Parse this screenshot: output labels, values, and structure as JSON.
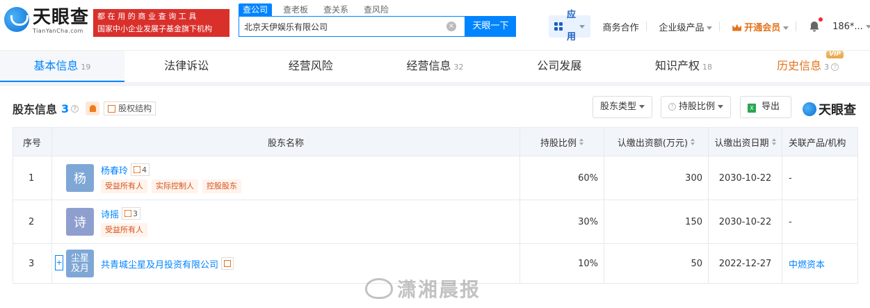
{
  "header": {
    "logo_cn": "天眼查",
    "logo_en": "TianYanCha.com",
    "slogan_line1": "都在用的商业查询工具",
    "slogan_line2": "国家中小企业发展子基金旗下机构",
    "search_tabs": [
      "查公司",
      "查老板",
      "查关系",
      "查风险"
    ],
    "search_value": "北京天伊娱乐有限公司",
    "search_button": "天眼一下",
    "nav": {
      "app": "应用",
      "business": "商务合作",
      "enterprise": "企业级产品",
      "vip": "开通会员",
      "user": "186*..."
    }
  },
  "tabs": [
    {
      "label": "基本信息",
      "count": "19"
    },
    {
      "label": "法律诉讼",
      "count": ""
    },
    {
      "label": "经营风险",
      "count": ""
    },
    {
      "label": "经营信息",
      "count": "32"
    },
    {
      "label": "公司发展",
      "count": ""
    },
    {
      "label": "知识产权",
      "count": "18"
    },
    {
      "label": "历史信息",
      "count": "3",
      "badge": "VIP"
    }
  ],
  "section": {
    "title": "股东信息",
    "count": "3",
    "structure_btn": "股权结构",
    "filter_type": "股东类型",
    "filter_ratio": "持股比例",
    "export": "导出",
    "brand": "天眼查"
  },
  "table": {
    "headers": [
      "序号",
      "股东名称",
      "持股比例",
      "认缴出资额(万元)",
      "认缴出资日期",
      "关联产品/机构"
    ],
    "rows": [
      {
        "index": "1",
        "avatar": "杨",
        "avatar_color": "#7fa7d6",
        "name": "杨春玲",
        "rel_count": "4",
        "tags": [
          "受益所有人",
          "实际控制人",
          "控股股东"
        ],
        "ratio": "60%",
        "amount": "300",
        "date": "2030-10-22",
        "related": "-"
      },
      {
        "index": "2",
        "avatar": "诗",
        "avatar_color": "#8e9fcf",
        "name": "诗摇",
        "rel_count": "3",
        "tags": [
          "受益所有人"
        ],
        "ratio": "30%",
        "amount": "150",
        "date": "2030-10-22",
        "related": "-"
      },
      {
        "index": "3",
        "avatar": "尘星\n及月",
        "avatar_color": "#7fa7d6",
        "name": "共青城尘星及月投资有限公司",
        "rel_count": "",
        "tags": [],
        "ratio": "10%",
        "amount": "50",
        "date": "2022-12-27",
        "related": "中燃资本"
      }
    ]
  },
  "watermark": "潇湘晨报"
}
